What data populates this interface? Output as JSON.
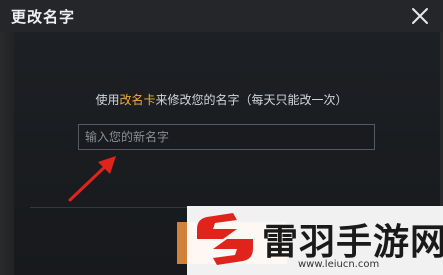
{
  "dialog": {
    "title": "更改名字",
    "close_icon": "close-icon",
    "instruction_prefix": "使用",
    "instruction_item": "改名卡",
    "instruction_suffix": "来修改您的名字（每天只能改一次）",
    "input_placeholder": "输入您的新名字",
    "input_value": "",
    "confirm_button_color": "#d2813a"
  },
  "annotation": {
    "arrow_color": "#e0241b"
  },
  "watermark": {
    "text": "雷羽手游网",
    "url": "www.leiucn.com",
    "logo_color": "#e0241b"
  }
}
